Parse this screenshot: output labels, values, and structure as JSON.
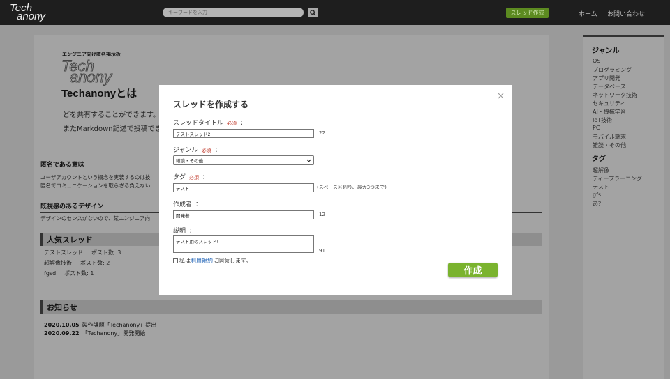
{
  "header": {
    "logo_line1": "Tech",
    "logo_line2": "anony",
    "search_placeholder": "キーワードを入力",
    "new_thread_label": "スレッド作成",
    "nav_home": "ホーム",
    "nav_contact": "お問い合わせ"
  },
  "main": {
    "tagline": "エンジニア向け匿名掲示板",
    "biglogo_line1": "Tech",
    "biglogo_line2": "anony",
    "about_title": "Techanonyとは",
    "intro_line1": "どを共有することができます。",
    "intro_line2": "またMarkdown記述で投稿できま",
    "sections": [
      {
        "title": "匿名である意味",
        "lines": [
          "ユーザアカウントという概念を実装するのは技",
          "匿名でコミュニケーションを取らざる負えない"
        ]
      },
      {
        "title": "既視感のあるデザイン",
        "lines": [
          "デザインのセンスがないので、某エンジニア向"
        ]
      }
    ],
    "popular": {
      "title": "人気スレッド",
      "items": [
        {
          "name": "テストスレッド",
          "count": "ポスト数: 3"
        },
        {
          "name": "超解像技術",
          "count": "ポスト数: 2"
        },
        {
          "name": "fgsd",
          "count": "ポスト数: 1"
        }
      ]
    },
    "news": {
      "title": "お知らせ",
      "items": [
        {
          "date": "2020.10.05",
          "text": "製作課題「Techanony」提出"
        },
        {
          "date": "2020.09.22",
          "text": "「Techanony」開発開始"
        }
      ]
    }
  },
  "sidebar": {
    "genre_title": "ジャンル",
    "genres": [
      "OS",
      "プログラミング",
      "アプリ開発",
      "データベース",
      "ネットワーク技術",
      "セキュリティ",
      "AI・機械学習",
      "IoT技術",
      "PC",
      "モバイル端末",
      "雑談・その他"
    ],
    "tag_title": "タグ",
    "tags": [
      "超解像",
      "ディープラーニング",
      "テスト",
      "gfs",
      "あ？"
    ]
  },
  "modal": {
    "title": "スレッドを作成する",
    "required_mark": "必須",
    "colon": "：",
    "thread_title_label": "スレッドタイトル",
    "thread_title_value": "テストスレッド2",
    "thread_title_count": "22",
    "genre_label": "ジャンル",
    "genre_value": "雑談・その他",
    "tag_label": "タグ",
    "tag_value": "テスト",
    "tag_hint": "(スペース区切り、最大3つまで)",
    "author_label": "作成者",
    "author_value": "開発者",
    "author_count": "12",
    "desc_label": "説明",
    "desc_value": "テスト用のスレッド!",
    "desc_count": "91",
    "agree_prefix": "私は",
    "agree_link": "利用規約",
    "agree_suffix": "に同意します。",
    "submit_label": "作成"
  },
  "colors": {
    "header_bg": "#1e1e1e",
    "accent_green": "#7ab32e",
    "required_red": "#c0392b",
    "link_blue": "#1a5fb4"
  }
}
